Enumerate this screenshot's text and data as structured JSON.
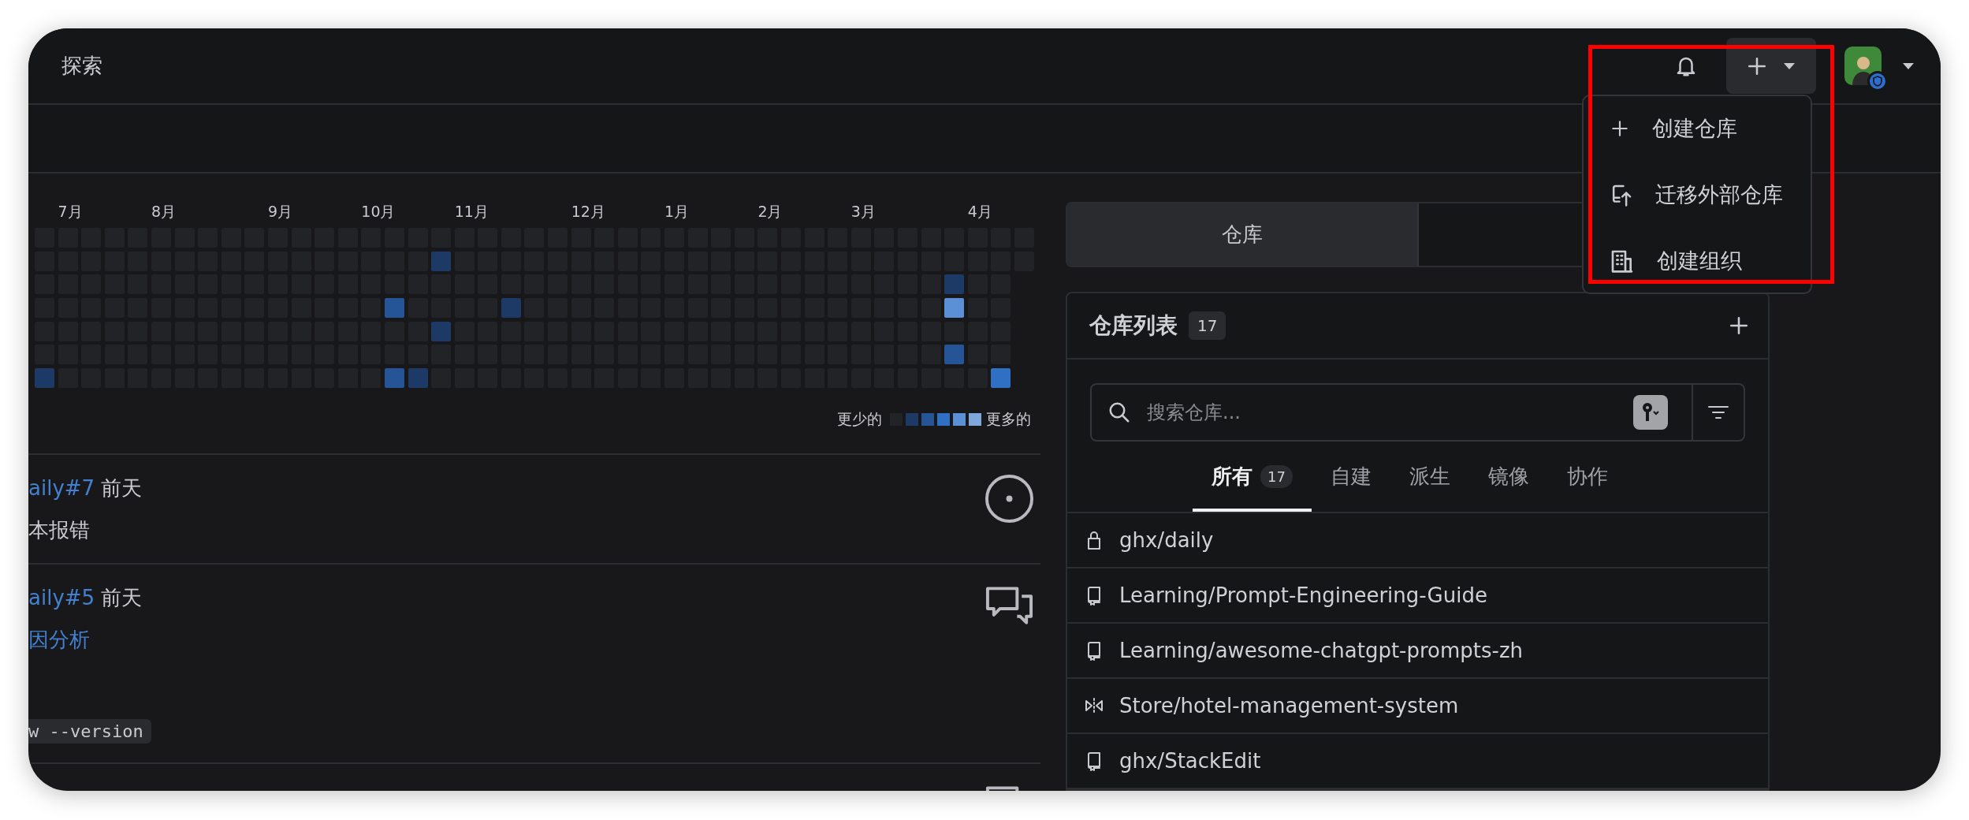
{
  "header": {
    "title": "探索"
  },
  "new_menu": {
    "expanded": true,
    "items": [
      {
        "kind": "create",
        "label": "创建仓库"
      },
      {
        "kind": "migrate",
        "label": "迁移外部仓库"
      },
      {
        "kind": "org",
        "label": "创建组织"
      }
    ]
  },
  "contributions": {
    "weeks": [
      {
        "days": [
          {
            "color": "#222327"
          },
          {
            "color": "#222327"
          },
          {
            "color": "#222327"
          },
          {
            "color": "#222327"
          },
          {
            "color": "#222327"
          },
          {
            "color": "#222327"
          },
          {
            "color": "#1d3a66"
          }
        ]
      },
      {
        "month": "7月",
        "days": [
          {
            "color": "#222327"
          },
          {
            "color": "#222327"
          },
          {
            "color": "#222327"
          },
          {
            "color": "#222327"
          },
          {
            "color": "#222327"
          },
          {
            "color": "#222327"
          },
          {
            "color": "#222327"
          }
        ]
      },
      {
        "days": [
          {
            "color": "#222327"
          },
          {
            "color": "#222327"
          },
          {
            "color": "#222327"
          },
          {
            "color": "#222327"
          },
          {
            "color": "#222327"
          },
          {
            "color": "#222327"
          },
          {
            "color": "#222327"
          }
        ]
      },
      {
        "days": [
          {
            "color": "#222327"
          },
          {
            "color": "#222327"
          },
          {
            "color": "#222327"
          },
          {
            "color": "#222327"
          },
          {
            "color": "#222327"
          },
          {
            "color": "#222327"
          },
          {
            "color": "#222327"
          }
        ]
      },
      {
        "days": [
          {
            "color": "#222327"
          },
          {
            "color": "#222327"
          },
          {
            "color": "#222327"
          },
          {
            "color": "#222327"
          },
          {
            "color": "#222327"
          },
          {
            "color": "#222327"
          },
          {
            "color": "#222327"
          }
        ]
      },
      {
        "month": "8月",
        "days": [
          {
            "color": "#222327"
          },
          {
            "color": "#222327"
          },
          {
            "color": "#222327"
          },
          {
            "color": "#222327"
          },
          {
            "color": "#222327"
          },
          {
            "color": "#222327"
          },
          {
            "color": "#222327"
          }
        ]
      },
      {
        "days": [
          {
            "color": "#222327"
          },
          {
            "color": "#222327"
          },
          {
            "color": "#222327"
          },
          {
            "color": "#222327"
          },
          {
            "color": "#222327"
          },
          {
            "color": "#222327"
          },
          {
            "color": "#222327"
          }
        ]
      },
      {
        "days": [
          {
            "color": "#222327"
          },
          {
            "color": "#222327"
          },
          {
            "color": "#222327"
          },
          {
            "color": "#222327"
          },
          {
            "color": "#222327"
          },
          {
            "color": "#222327"
          },
          {
            "color": "#222327"
          }
        ]
      },
      {
        "days": [
          {
            "color": "#222327"
          },
          {
            "color": "#222327"
          },
          {
            "color": "#222327"
          },
          {
            "color": "#222327"
          },
          {
            "color": "#222327"
          },
          {
            "color": "#222327"
          },
          {
            "color": "#222327"
          }
        ]
      },
      {
        "days": [
          {
            "color": "#222327"
          },
          {
            "color": "#222327"
          },
          {
            "color": "#222327"
          },
          {
            "color": "#222327"
          },
          {
            "color": "#222327"
          },
          {
            "color": "#222327"
          },
          {
            "color": "#222327"
          }
        ]
      },
      {
        "month": "9月",
        "days": [
          {
            "color": "#222327"
          },
          {
            "color": "#222327"
          },
          {
            "color": "#222327"
          },
          {
            "color": "#222327"
          },
          {
            "color": "#222327"
          },
          {
            "color": "#222327"
          },
          {
            "color": "#222327"
          }
        ]
      },
      {
        "days": [
          {
            "color": "#222327"
          },
          {
            "color": "#222327"
          },
          {
            "color": "#222327"
          },
          {
            "color": "#222327"
          },
          {
            "color": "#222327"
          },
          {
            "color": "#222327"
          },
          {
            "color": "#222327"
          }
        ]
      },
      {
        "days": [
          {
            "color": "#222327"
          },
          {
            "color": "#222327"
          },
          {
            "color": "#222327"
          },
          {
            "color": "#222327"
          },
          {
            "color": "#222327"
          },
          {
            "color": "#222327"
          },
          {
            "color": "#222327"
          }
        ]
      },
      {
        "days": [
          {
            "color": "#222327"
          },
          {
            "color": "#222327"
          },
          {
            "color": "#222327"
          },
          {
            "color": "#222327"
          },
          {
            "color": "#222327"
          },
          {
            "color": "#222327"
          },
          {
            "color": "#222327"
          }
        ]
      },
      {
        "month": "10月",
        "days": [
          {
            "color": "#222327"
          },
          {
            "color": "#222327"
          },
          {
            "color": "#222327"
          },
          {
            "color": "#222327"
          },
          {
            "color": "#222327"
          },
          {
            "color": "#222327"
          },
          {
            "color": "#222327"
          }
        ]
      },
      {
        "days": [
          {
            "color": "#222327"
          },
          {
            "color": "#222327"
          },
          {
            "color": "#222327"
          },
          {
            "color": "#255596"
          },
          {
            "color": "#222327"
          },
          {
            "color": "#222327"
          },
          {
            "color": "#255596"
          }
        ]
      },
      {
        "days": [
          {
            "color": "#222327"
          },
          {
            "color": "#222327"
          },
          {
            "color": "#222327"
          },
          {
            "color": "#222327"
          },
          {
            "color": "#222327"
          },
          {
            "color": "#222327"
          },
          {
            "color": "#1d3a66"
          }
        ]
      },
      {
        "days": [
          {
            "color": "#222327"
          },
          {
            "color": "#1d3a66"
          },
          {
            "color": "#222327"
          },
          {
            "color": "#222327"
          },
          {
            "color": "#1d3a66"
          },
          {
            "color": "#222327"
          },
          {
            "color": "#222327"
          }
        ]
      },
      {
        "month": "11月",
        "days": [
          {
            "color": "#222327"
          },
          {
            "color": "#222327"
          },
          {
            "color": "#222327"
          },
          {
            "color": "#222327"
          },
          {
            "color": "#222327"
          },
          {
            "color": "#222327"
          },
          {
            "color": "#222327"
          }
        ]
      },
      {
        "days": [
          {
            "color": "#222327"
          },
          {
            "color": "#222327"
          },
          {
            "color": "#222327"
          },
          {
            "color": "#222327"
          },
          {
            "color": "#222327"
          },
          {
            "color": "#222327"
          },
          {
            "color": "#222327"
          }
        ]
      },
      {
        "days": [
          {
            "color": "#222327"
          },
          {
            "color": "#222327"
          },
          {
            "color": "#222327"
          },
          {
            "color": "#1d3a66"
          },
          {
            "color": "#222327"
          },
          {
            "color": "#222327"
          },
          {
            "color": "#222327"
          }
        ]
      },
      {
        "days": [
          {
            "color": "#222327"
          },
          {
            "color": "#222327"
          },
          {
            "color": "#222327"
          },
          {
            "color": "#222327"
          },
          {
            "color": "#222327"
          },
          {
            "color": "#222327"
          },
          {
            "color": "#222327"
          }
        ]
      },
      {
        "days": [
          {
            "color": "#222327"
          },
          {
            "color": "#222327"
          },
          {
            "color": "#222327"
          },
          {
            "color": "#222327"
          },
          {
            "color": "#222327"
          },
          {
            "color": "#222327"
          },
          {
            "color": "#222327"
          }
        ]
      },
      {
        "month": "12月",
        "days": [
          {
            "color": "#222327"
          },
          {
            "color": "#222327"
          },
          {
            "color": "#222327"
          },
          {
            "color": "#222327"
          },
          {
            "color": "#222327"
          },
          {
            "color": "#222327"
          },
          {
            "color": "#222327"
          }
        ]
      },
      {
        "days": [
          {
            "color": "#222327"
          },
          {
            "color": "#222327"
          },
          {
            "color": "#222327"
          },
          {
            "color": "#222327"
          },
          {
            "color": "#222327"
          },
          {
            "color": "#222327"
          },
          {
            "color": "#222327"
          }
        ]
      },
      {
        "days": [
          {
            "color": "#222327"
          },
          {
            "color": "#222327"
          },
          {
            "color": "#222327"
          },
          {
            "color": "#222327"
          },
          {
            "color": "#222327"
          },
          {
            "color": "#222327"
          },
          {
            "color": "#222327"
          }
        ]
      },
      {
        "days": [
          {
            "color": "#222327"
          },
          {
            "color": "#222327"
          },
          {
            "color": "#222327"
          },
          {
            "color": "#222327"
          },
          {
            "color": "#222327"
          },
          {
            "color": "#222327"
          },
          {
            "color": "#222327"
          }
        ]
      },
      {
        "month": "1月",
        "days": [
          {
            "color": "#222327"
          },
          {
            "color": "#222327"
          },
          {
            "color": "#222327"
          },
          {
            "color": "#222327"
          },
          {
            "color": "#222327"
          },
          {
            "color": "#222327"
          },
          {
            "color": "#222327"
          }
        ]
      },
      {
        "days": [
          {
            "color": "#222327"
          },
          {
            "color": "#222327"
          },
          {
            "color": "#222327"
          },
          {
            "color": "#222327"
          },
          {
            "color": "#222327"
          },
          {
            "color": "#222327"
          },
          {
            "color": "#222327"
          }
        ]
      },
      {
        "days": [
          {
            "color": "#222327"
          },
          {
            "color": "#222327"
          },
          {
            "color": "#222327"
          },
          {
            "color": "#222327"
          },
          {
            "color": "#222327"
          },
          {
            "color": "#222327"
          },
          {
            "color": "#222327"
          }
        ]
      },
      {
        "days": [
          {
            "color": "#222327"
          },
          {
            "color": "#222327"
          },
          {
            "color": "#222327"
          },
          {
            "color": "#222327"
          },
          {
            "color": "#222327"
          },
          {
            "color": "#222327"
          },
          {
            "color": "#222327"
          }
        ]
      },
      {
        "month": "2月",
        "days": [
          {
            "color": "#222327"
          },
          {
            "color": "#222327"
          },
          {
            "color": "#222327"
          },
          {
            "color": "#222327"
          },
          {
            "color": "#222327"
          },
          {
            "color": "#222327"
          },
          {
            "color": "#222327"
          }
        ]
      },
      {
        "days": [
          {
            "color": "#222327"
          },
          {
            "color": "#222327"
          },
          {
            "color": "#222327"
          },
          {
            "color": "#222327"
          },
          {
            "color": "#222327"
          },
          {
            "color": "#222327"
          },
          {
            "color": "#222327"
          }
        ]
      },
      {
        "days": [
          {
            "color": "#222327"
          },
          {
            "color": "#222327"
          },
          {
            "color": "#222327"
          },
          {
            "color": "#222327"
          },
          {
            "color": "#222327"
          },
          {
            "color": "#222327"
          },
          {
            "color": "#222327"
          }
        ]
      },
      {
        "days": [
          {
            "color": "#222327"
          },
          {
            "color": "#222327"
          },
          {
            "color": "#222327"
          },
          {
            "color": "#222327"
          },
          {
            "color": "#222327"
          },
          {
            "color": "#222327"
          },
          {
            "color": "#222327"
          }
        ]
      },
      {
        "month": "3月",
        "days": [
          {
            "color": "#222327"
          },
          {
            "color": "#222327"
          },
          {
            "color": "#222327"
          },
          {
            "color": "#222327"
          },
          {
            "color": "#222327"
          },
          {
            "color": "#222327"
          },
          {
            "color": "#222327"
          }
        ]
      },
      {
        "days": [
          {
            "color": "#222327"
          },
          {
            "color": "#222327"
          },
          {
            "color": "#222327"
          },
          {
            "color": "#222327"
          },
          {
            "color": "#222327"
          },
          {
            "color": "#222327"
          },
          {
            "color": "#222327"
          }
        ]
      },
      {
        "days": [
          {
            "color": "#222327"
          },
          {
            "color": "#222327"
          },
          {
            "color": "#222327"
          },
          {
            "color": "#222327"
          },
          {
            "color": "#222327"
          },
          {
            "color": "#222327"
          },
          {
            "color": "#222327"
          }
        ]
      },
      {
        "days": [
          {
            "color": "#222327"
          },
          {
            "color": "#222327"
          },
          {
            "color": "#222327"
          },
          {
            "color": "#222327"
          },
          {
            "color": "#222327"
          },
          {
            "color": "#222327"
          },
          {
            "color": "#222327"
          }
        ]
      },
      {
        "days": [
          {
            "color": "#222327"
          },
          {
            "color": "#222327"
          },
          {
            "color": "#1d3a66"
          },
          {
            "color": "#5b8fd6"
          },
          {
            "color": "#222327"
          },
          {
            "color": "#255596"
          },
          {
            "color": "#222327"
          }
        ]
      },
      {
        "month": "4月",
        "days": [
          {
            "color": "#222327"
          },
          {
            "color": "#222327"
          },
          {
            "color": "#222327"
          },
          {
            "color": "#222327"
          },
          {
            "color": "#222327"
          },
          {
            "color": "#222327"
          },
          {
            "color": "#222327"
          }
        ]
      },
      {
        "days": [
          {
            "color": "#222327"
          },
          {
            "color": "#222327"
          },
          {
            "color": "#222327"
          },
          {
            "color": "#222327"
          },
          {
            "color": "#222327"
          },
          {
            "color": "#222327"
          },
          {
            "color": "#2f6fc4"
          }
        ]
      },
      {
        "days": [
          {
            "color": "#222327"
          },
          {
            "color": "#222327"
          }
        ]
      }
    ],
    "legend": {
      "less": "更少的",
      "more": "更多的"
    }
  },
  "feed": [
    {
      "kind": "issue",
      "link": "aily#7",
      "time": "前天",
      "lines": [
        {
          "kind": "text",
          "text": "本报错"
        }
      ]
    },
    {
      "kind": "discussion",
      "link": "aily#5",
      "time": "前天",
      "lines": [
        {
          "kind": "link",
          "text": "因分析"
        },
        {
          "kind": "code",
          "text": "w --version"
        }
      ]
    },
    {
      "kind": "discussion"
    }
  ],
  "side_tabs": [
    {
      "label": "仓库",
      "selected": true
    },
    {
      "selected": false
    }
  ],
  "repos": {
    "title": "仓库列表",
    "count": "17",
    "search": {
      "placeholder": "搜索仓库..."
    },
    "filters": [
      {
        "label": "所有",
        "count": "17",
        "selected": true
      },
      {
        "label": "自建",
        "selected": false
      },
      {
        "label": "派生",
        "selected": false
      },
      {
        "label": "镜像",
        "selected": false
      },
      {
        "label": "协作",
        "selected": false
      }
    ],
    "rows": [
      {
        "kind": "private",
        "name": "ghx/daily"
      },
      {
        "kind": "repo",
        "name": "Learning/Prompt-Engineering-Guide"
      },
      {
        "kind": "repo",
        "name": "Learning/awesome-chatgpt-prompts-zh"
      },
      {
        "kind": "mirror",
        "name": "Store/hotel-management-system"
      },
      {
        "kind": "repo",
        "name": "ghx/StackEdit"
      }
    ]
  }
}
